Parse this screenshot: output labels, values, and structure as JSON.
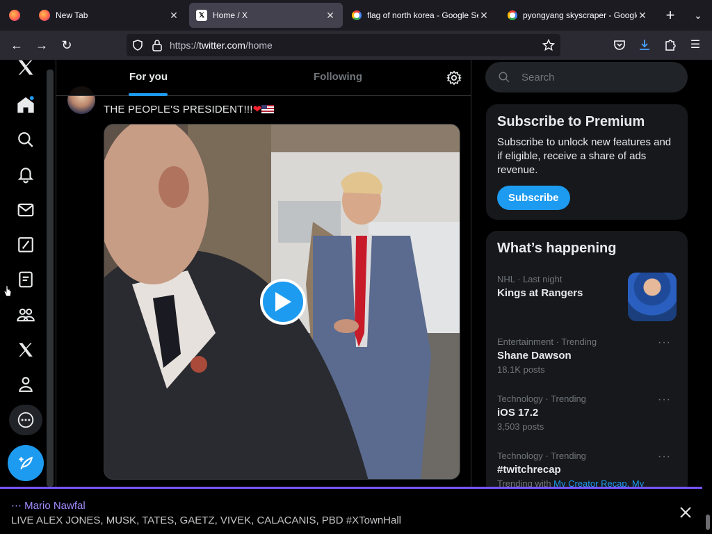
{
  "browser": {
    "tabs": [
      {
        "title": "",
        "kind": "firefox"
      },
      {
        "title": "New Tab",
        "kind": "firefox"
      },
      {
        "title": "Home / X",
        "kind": "x",
        "active": true
      },
      {
        "title": "flag of north korea - Google Se",
        "kind": "google"
      },
      {
        "title": "pyongyang skyscraper - Google",
        "kind": "google"
      }
    ],
    "url": {
      "protocol": "https://",
      "host": "twitter.com",
      "path": "/home"
    }
  },
  "timeline": {
    "tabs": [
      "For you",
      "Following"
    ],
    "tweet": {
      "text": "THE PEOPLE'S PRESIDENT!!!",
      "heart": "❤"
    }
  },
  "sidebar": {
    "search_placeholder": "Search",
    "premium": {
      "title": "Subscribe to Premium",
      "description": "Subscribe to unlock new features and if eligible, receive a share of ads revenue.",
      "button": "Subscribe"
    },
    "happening": {
      "title": "What’s happening",
      "trends": [
        {
          "meta": "NHL · Last night",
          "name": "Kings at Rangers"
        },
        {
          "meta": "Entertainment · Trending",
          "name": "Shane Dawson",
          "count": "18.1K posts"
        },
        {
          "meta": "Technology · Trending",
          "name": "iOS 17.2",
          "count": "3,503 posts"
        },
        {
          "meta": "Technology · Trending",
          "name": "#twitchrecap",
          "sub": "Trending with ",
          "sub_link": "My Creator Recap, My"
        }
      ]
    }
  },
  "spaces": {
    "host": "Mario Nawfal",
    "title": "LIVE ALEX JONES, MUSK, TATES, GAETZ, VIVEK, CALACANIS, PBD #XTownHall"
  },
  "colors": {
    "accent": "#1d9bf0",
    "spaces": "#7856ff",
    "like": "#f4212e"
  }
}
